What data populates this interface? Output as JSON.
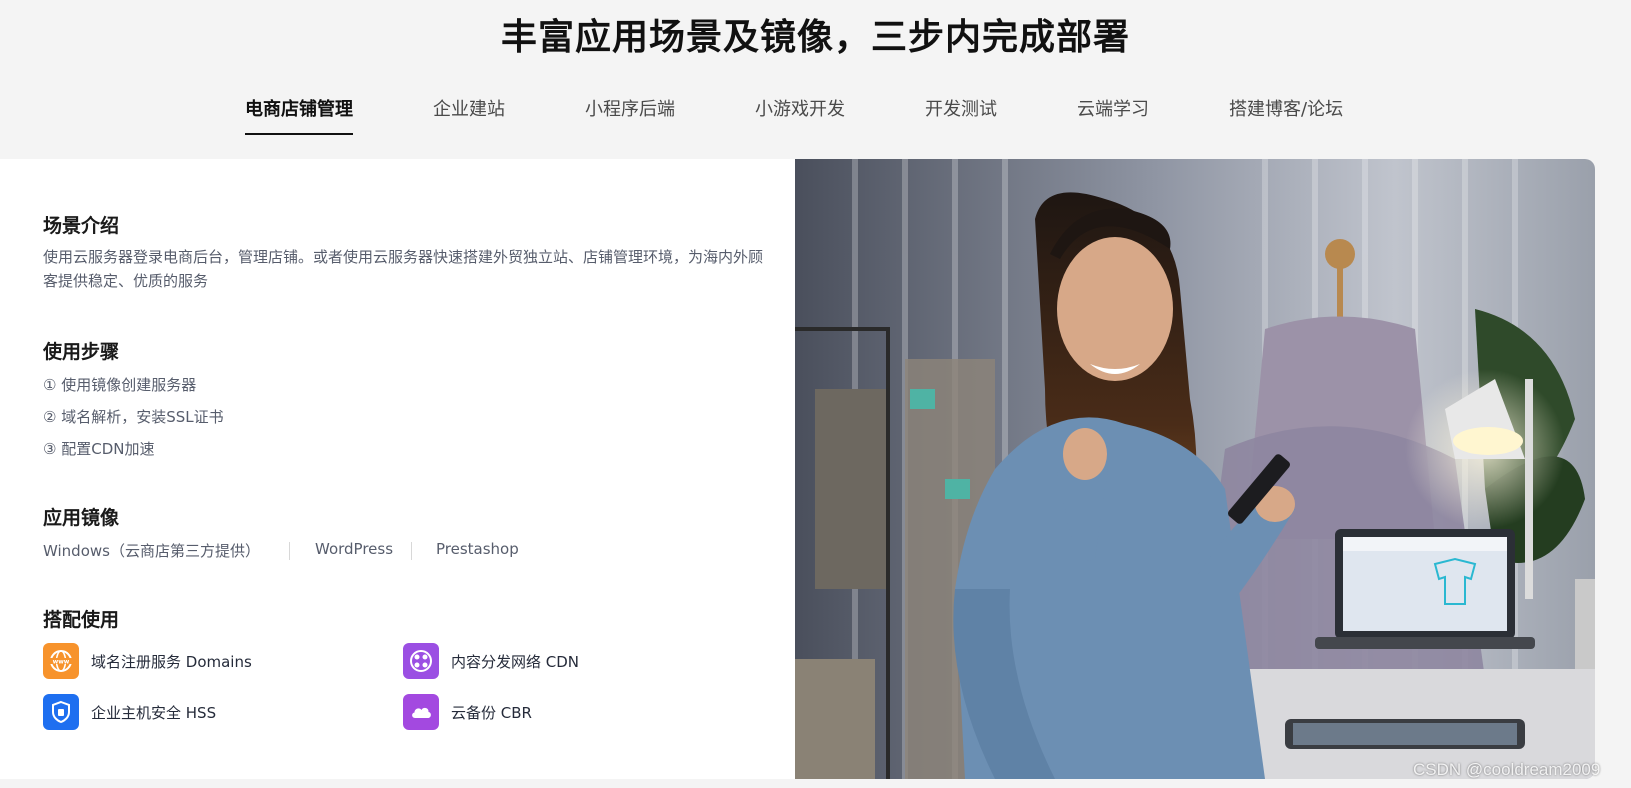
{
  "page_title": "丰富应用场景及镜像，三步内完成部署",
  "tabs": [
    {
      "label": "电商店铺管理",
      "active": true
    },
    {
      "label": "企业建站"
    },
    {
      "label": "小程序后端"
    },
    {
      "label": "小游戏开发"
    },
    {
      "label": "开发测试"
    },
    {
      "label": "云端学习"
    },
    {
      "label": "搭建博客/论坛"
    }
  ],
  "scene": {
    "title": "场景介绍",
    "description": "使用云服务器登录电商后台，管理店铺。或者使用云服务器快速搭建外贸独立站、店铺管理环境，为海内外顾客提供稳定、优质的服务"
  },
  "steps": {
    "title": "使用步骤",
    "items": [
      "① 使用镜像创建服务器",
      "② 域名解析，安装SSL证书",
      "③ 配置CDN加速"
    ]
  },
  "images": {
    "title": "应用镜像",
    "items": [
      "Windows（云商店第三方提供）",
      "WordPress",
      "Prestashop"
    ]
  },
  "combo": {
    "title": "搭配使用",
    "items": [
      {
        "label": "域名注册服务 Domains",
        "icon": "www-globe-icon",
        "color": "#f7932c"
      },
      {
        "label": "内容分发网络 CDN",
        "icon": "network-nodes-icon",
        "color": "#9b4fe3"
      },
      {
        "label": "企业主机安全 HSS",
        "icon": "shield-icon",
        "color": "#1e6ff0"
      },
      {
        "label": "云备份 CBR",
        "icon": "cloud-icon",
        "color": "#a349e0"
      }
    ]
  },
  "watermark": "CSDN @cooldream2009"
}
